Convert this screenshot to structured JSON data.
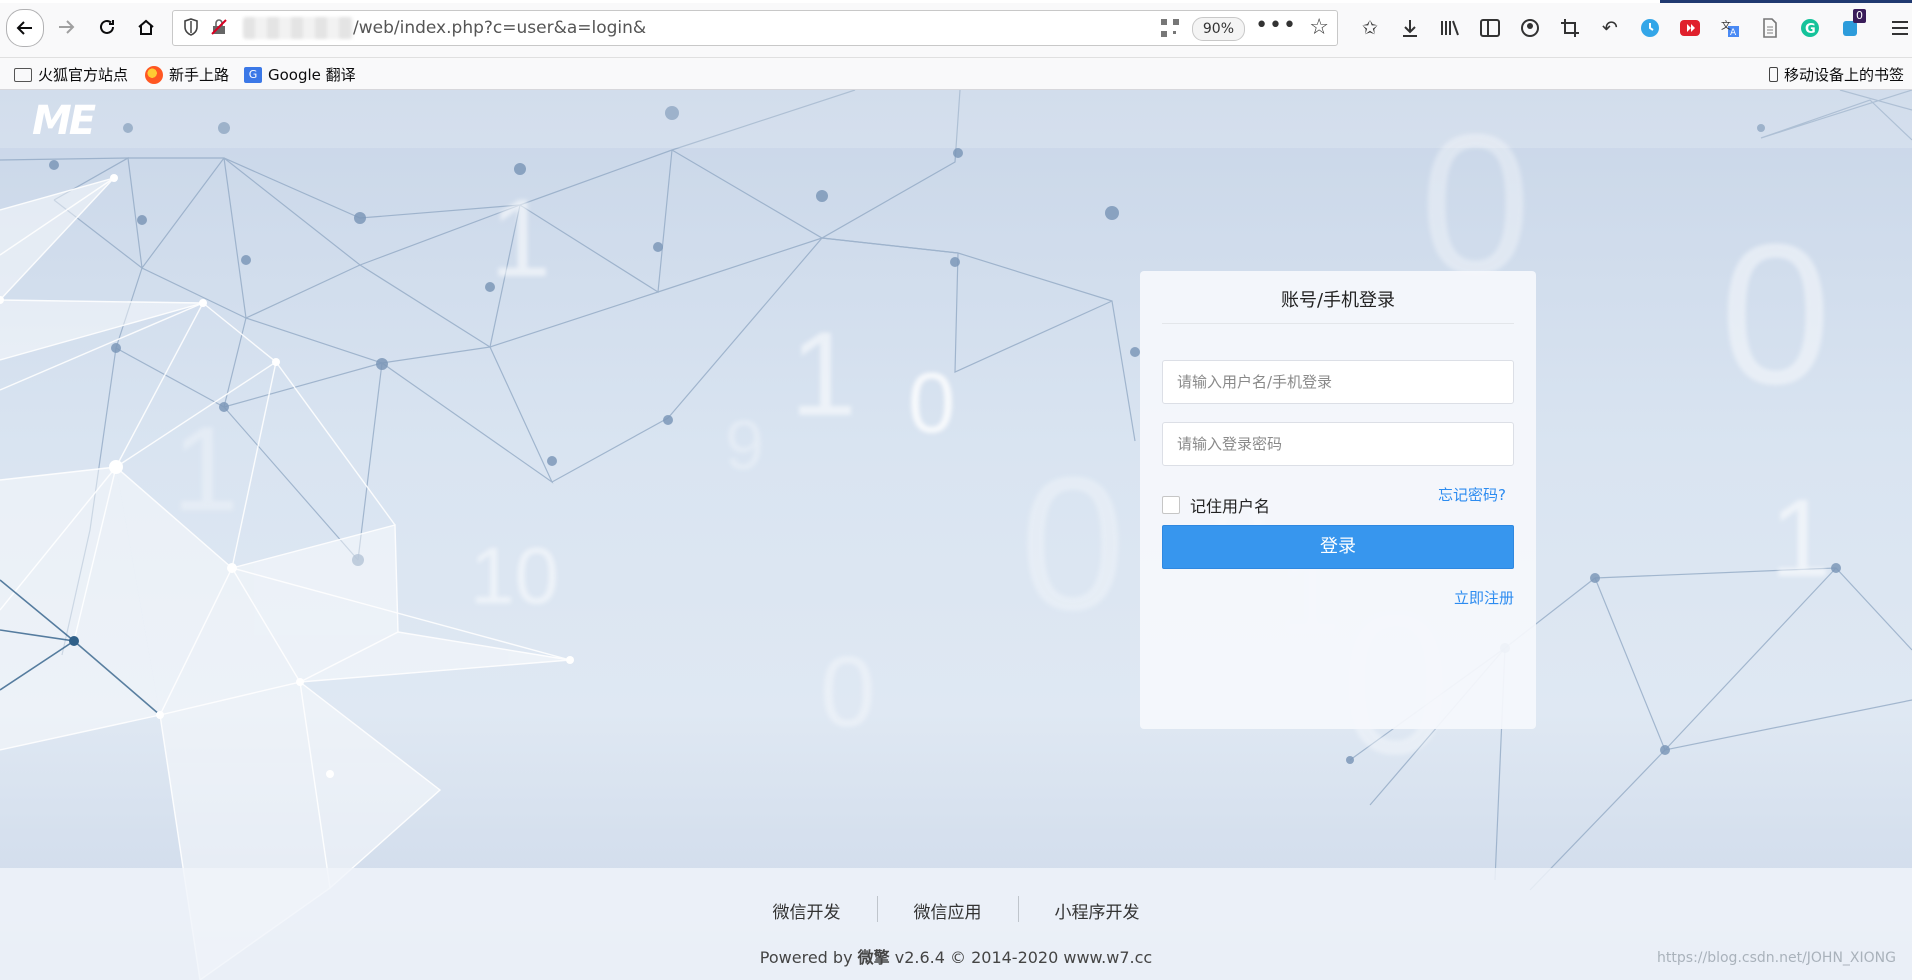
{
  "browser": {
    "url_visible": "/web/index.php?c=user&a=login&",
    "zoom": "90%",
    "bookmarks": [
      {
        "label": "火狐官方站点",
        "icon": "folder-icon"
      },
      {
        "label": "新手上路",
        "icon": "firefox-icon"
      },
      {
        "label": "Google 翻译",
        "icon": "google-translate-icon"
      }
    ],
    "mobile_bookmarks": "移动设备上的书签",
    "extension_badge": "0"
  },
  "page": {
    "logo": "ME",
    "login": {
      "title": "账号/手机登录",
      "username_placeholder": "请输入用户名/手机登录",
      "password_placeholder": "请输入登录密码",
      "remember_label": "记住用户名",
      "forgot_label": "忘记密码?",
      "login_button": "登录",
      "register_link": "立即注册"
    },
    "footer": {
      "links": [
        "微信开发",
        "微信应用",
        "小程序开发"
      ],
      "copyright_prefix": "Powered by ",
      "brand": "微擎",
      "copyright_suffix": " v2.6.4 © 2014-2020 www.w7.cc"
    },
    "watermark": "https://blog.csdn.net/JOHN_XIONG"
  },
  "colors": {
    "accent": "#3796ee",
    "link": "#2d8cf0"
  }
}
